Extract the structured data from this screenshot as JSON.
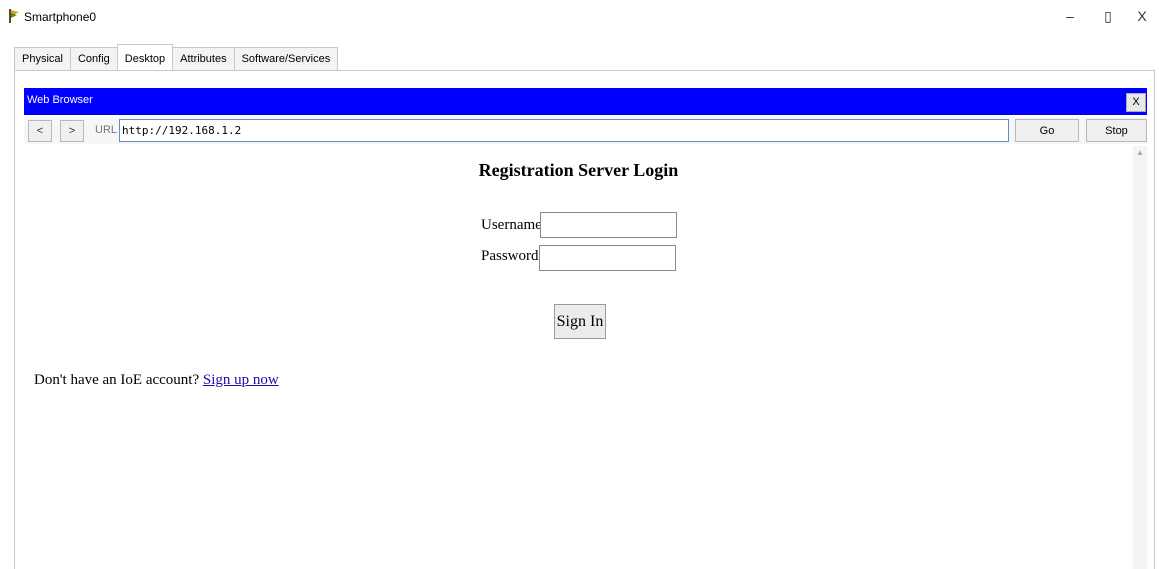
{
  "window": {
    "title": "Smartphone0",
    "controls": {
      "minimize": "–",
      "maximize": "▯",
      "close": "X"
    }
  },
  "tabs": [
    {
      "label": "Physical",
      "active": false
    },
    {
      "label": "Config",
      "active": false
    },
    {
      "label": "Desktop",
      "active": true
    },
    {
      "label": "Attributes",
      "active": false
    },
    {
      "label": "Software/Services",
      "active": false
    }
  ],
  "browser": {
    "title": "Web Browser",
    "close_label": "X",
    "back_label": "<",
    "forward_label": ">",
    "url_label": "URL",
    "url_value": "http://192.168.1.2",
    "go_label": "Go",
    "stop_label": "Stop",
    "header_color": "#0000ff"
  },
  "page": {
    "heading": "Registration Server Login",
    "username_label": "Username:",
    "username_value": "",
    "password_label": "Password:",
    "password_value": "",
    "signin_label": "Sign In",
    "signup_prompt": "Don't have an IoE account?",
    "signup_link": "Sign up now",
    "link_color": "#1a0dab"
  }
}
